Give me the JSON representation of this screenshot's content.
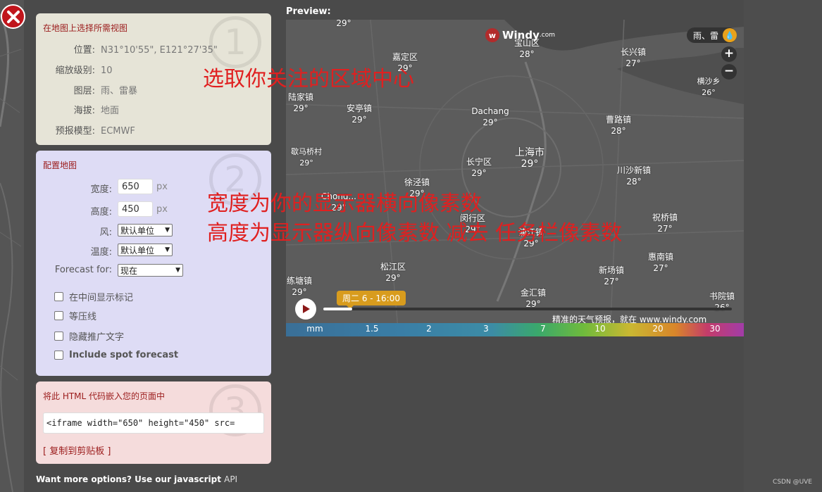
{
  "close": {
    "icon": "close-icon"
  },
  "panel1": {
    "title": "在地图上选择所需视图",
    "number": "1",
    "rows": [
      {
        "key": "位置:",
        "value": "N31°10'55\", E121°27'35\""
      },
      {
        "key": "缩放级别:",
        "value": "10"
      },
      {
        "key": "图层:",
        "value": "雨、雷暴"
      },
      {
        "key": "海拔:",
        "value": "地面"
      },
      {
        "key": "预报模型:",
        "value": "ECMWF"
      }
    ]
  },
  "panel2": {
    "title": "配置地图",
    "number": "2",
    "width_label": "宽度:",
    "width_value": "650",
    "width_unit": "px",
    "height_label": "高度:",
    "height_value": "450",
    "height_unit": "px",
    "wind_label": "风:",
    "wind_value": "默认单位",
    "temp_label": "温度:",
    "temp_value": "默认单位",
    "forecast_label": "Forecast for:",
    "forecast_value": "现在",
    "checks": [
      "在中间显示标记",
      "等压线",
      "隐藏推广文字",
      "Include spot forecast"
    ]
  },
  "panel3": {
    "title": "将此 HTML 代码嵌入您的页面中",
    "number": "3",
    "code": "<iframe width=\"650\" height=\"450\" src=",
    "copy_link": "[ 复制到剪贴板 ]"
  },
  "footer": {
    "text": "Want more options? Use our javascript ",
    "api": "API"
  },
  "watermark": "CSDN @UVE",
  "preview": {
    "title": "Preview:",
    "logo_text": "Windy",
    "logo_suffix": ".com",
    "layer": "雨、雷",
    "zoom_in": "+",
    "zoom_out": "−",
    "time": "周二 6 - 16:00",
    "progress": 0.07,
    "promo": "精准的天气预报，就在 www.windy.com",
    "legend_unit": "mm",
    "legend_ticks": [
      "1.5",
      "2",
      "3",
      "7",
      "10",
      "20",
      "30"
    ],
    "places": [
      {
        "name": "",
        "temp": "29°"
      },
      {
        "name": "宝山区",
        "temp": "28°"
      },
      {
        "name": "长兴镇",
        "temp": "27°"
      },
      {
        "name": "嘉定区",
        "temp": "29°"
      },
      {
        "name": "横沙乡",
        "temp": "26°"
      },
      {
        "name": "陆家镇",
        "temp": "29°"
      },
      {
        "name": "安亭镇",
        "temp": "29°"
      },
      {
        "name": "Dachang",
        "temp": "29°"
      },
      {
        "name": "曹路镇",
        "temp": "28°"
      },
      {
        "name": "歇马桥村",
        "temp": "29°"
      },
      {
        "name": "长宁区",
        "temp": "29°"
      },
      {
        "name": "上海市",
        "temp": "29°"
      },
      {
        "name": "川沙新镇",
        "temp": "28°"
      },
      {
        "name": "徐泾镇",
        "temp": "29°"
      },
      {
        "name": "Chong...",
        "temp": "29°"
      },
      {
        "name": "闵行区",
        "temp": "29°"
      },
      {
        "name": "浦江镇",
        "temp": "29°"
      },
      {
        "name": "祝桥镇",
        "temp": "27°"
      },
      {
        "name": "惠南镇",
        "temp": "27°"
      },
      {
        "name": "松江区",
        "temp": "29°"
      },
      {
        "name": "新场镇",
        "temp": "27°"
      },
      {
        "name": "练塘镇",
        "temp": "29°"
      },
      {
        "name": "金汇镇",
        "temp": "29°"
      },
      {
        "name": "书院镇",
        "temp": "26°"
      }
    ]
  },
  "annotations": {
    "a1": "选取你关注的区域中心",
    "a2": "宽度为你的显示器横向像素数",
    "a3": "高度为显示器纵向像素数 减去 任务栏像素数"
  }
}
